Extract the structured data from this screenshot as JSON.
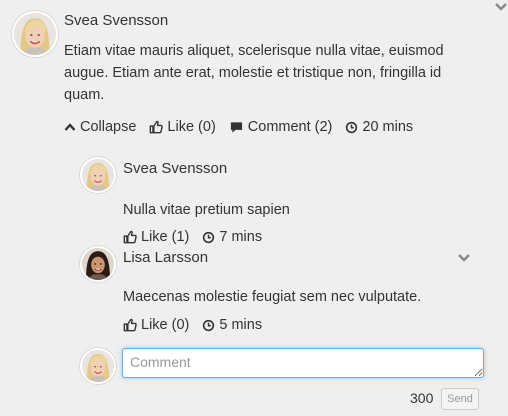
{
  "main_comment": {
    "author": "Svea Svensson",
    "text": "Etiam vitae mauris aliquet, scelerisque nulla vitae, euismod augue. Etiam ante erat, molestie et tristique non, fringilla id quam.",
    "collapse_label": "Collapse",
    "like_label": "Like (0)",
    "comment_label": "Comment (2)",
    "time_label": "20 mins"
  },
  "replies": [
    {
      "author": "Svea Svensson",
      "text": "Nulla vitae pretium sapien",
      "like_label": "Like (1)",
      "time_label": "7 mins"
    },
    {
      "author": "Lisa Larsson",
      "text": "Maecenas molestie feugiat sem nec vulputate.",
      "like_label": "Like (0)",
      "time_label": "5 mins"
    }
  ],
  "composer": {
    "placeholder": "Comment",
    "value": "",
    "char_count": "300",
    "send_label": "Send"
  },
  "icons": {
    "collapse": "chevron-up-icon",
    "like": "thumbs-up-icon",
    "comment": "speech-bubble-icon",
    "time": "clock-icon",
    "menu": "chevron-down-icon"
  },
  "colors": {
    "background": "#efefef",
    "text": "#333333",
    "focus_border": "#66afe9"
  }
}
